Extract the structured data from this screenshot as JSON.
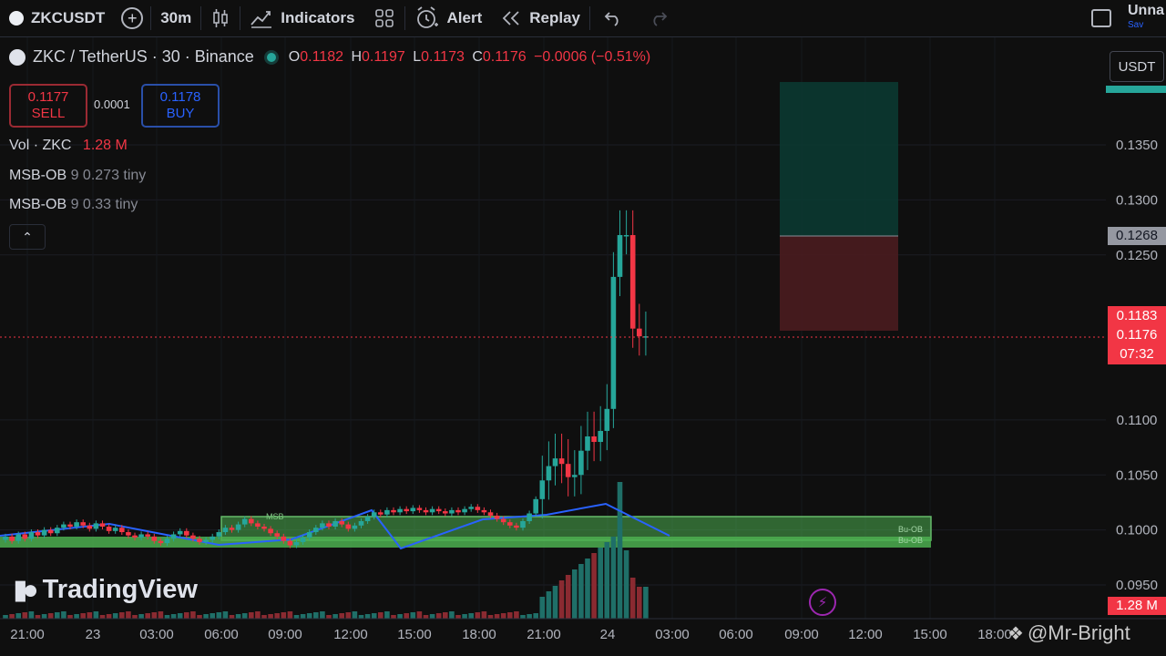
{
  "toolbar": {
    "symbol": "ZKCUSDT",
    "interval": "30m",
    "indicators_label": "Indicators",
    "alert_label": "Alert",
    "replay_label": "Replay",
    "layout_name": "Unna",
    "layout_status": "Sav"
  },
  "legend": {
    "title": "ZKC / TetherUS · 30 · Binance",
    "o_key": "O",
    "o": "0.1182",
    "h_key": "H",
    "h": "0.1197",
    "l_key": "L",
    "l": "0.1173",
    "c_key": "C",
    "c": "0.1176",
    "change": "−0.0006 (−0.51%)"
  },
  "trade": {
    "sell_price": "0.1177",
    "sell_label": "SELL",
    "spread": "0.0001",
    "buy_price": "0.1178",
    "buy_label": "BUY"
  },
  "indicators": {
    "volume": {
      "name": "Vol · ZKC",
      "value": "1.28 M"
    },
    "msb1": {
      "name": "MSB-OB",
      "value": "9 0.273 tiny"
    },
    "msb2": {
      "name": "MSB-OB",
      "value": "9 0.33 tiny"
    }
  },
  "currency": "USDT",
  "price_axis": {
    "ticks": [
      "0.1350",
      "0.1300",
      "0.1250",
      "0.1100",
      "0.1050",
      "0.1000",
      "0.0950"
    ],
    "tick_values": [
      0.135,
      0.13,
      0.125,
      0.11,
      0.105,
      0.1,
      0.095
    ],
    "highlight_label": "0.1268",
    "current_price_label": "0.1183",
    "last_price_label": "0.1176",
    "countdown": "07:32",
    "volume_label": "1.28 M"
  },
  "time_axis": {
    "labels": [
      "21:00",
      "23",
      "03:00",
      "06:00",
      "09:00",
      "12:00",
      "15:00",
      "18:00",
      "21:00",
      "24",
      "03:00",
      "06:00",
      "09:00",
      "12:00",
      "15:00",
      "18:00"
    ]
  },
  "zone_labels": {
    "msb": "MSB",
    "bu_ob": "Bu-OB",
    "bu_ob2": "Bu-OB"
  },
  "brand": {
    "name": "TradingView"
  },
  "watermark": "@Mr-Bright",
  "colors": {
    "up": "#26a69a",
    "down": "#f23645",
    "zone": "#4caf50",
    "target": "#0b3b33",
    "stop": "#4a1c1f",
    "zigzag": "#2962ff"
  },
  "icons": {
    "add": "plus-circle-icon",
    "candles": "candles-icon",
    "indicators": "chart-line-icon",
    "templates": "grid-icon",
    "alert": "alarm-clock-icon",
    "replay": "rewind-icon",
    "undo": "undo-icon",
    "redo": "redo-icon",
    "layout": "square-icon",
    "bolt": "lightning-icon"
  }
}
